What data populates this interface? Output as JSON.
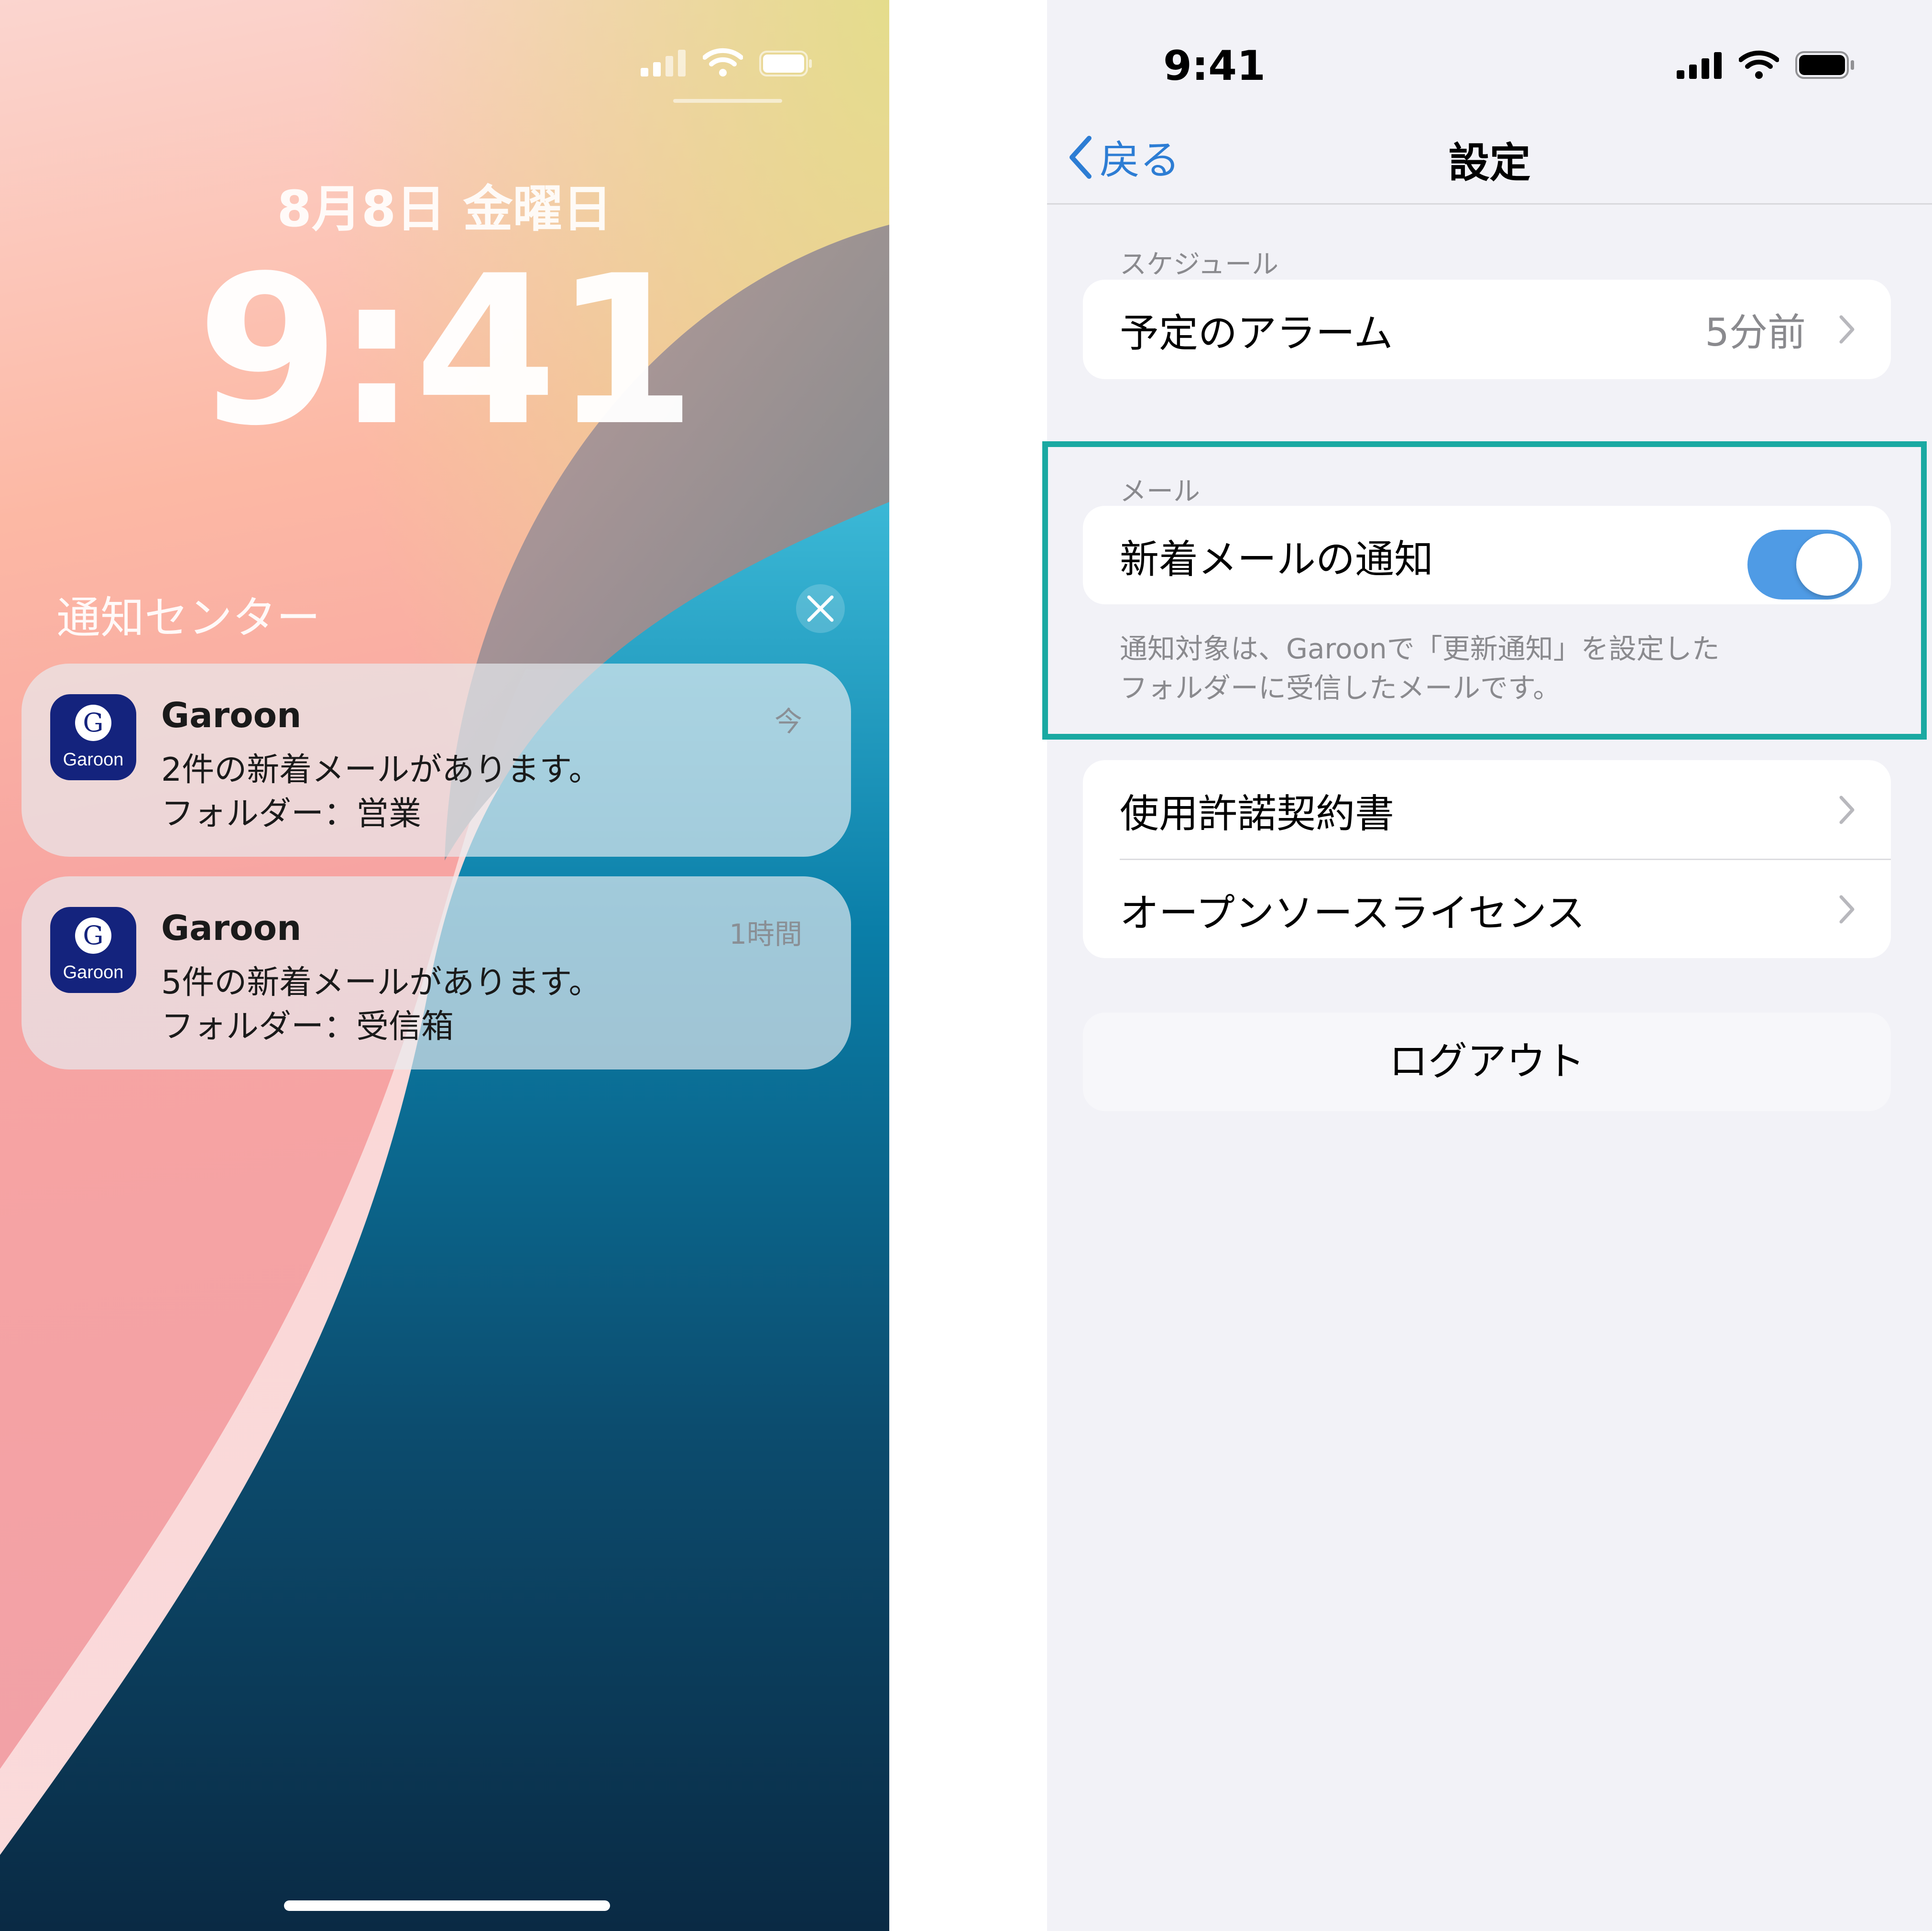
{
  "lock_screen": {
    "date": "8月8日 金曜日",
    "time": "9:41",
    "notification_center_title": "通知センター",
    "notifications": [
      {
        "app": "Garoon",
        "icon_text": "Garoon",
        "icon_letter": "G",
        "time": "今",
        "line1": "2件の新着メールがあります。",
        "line2": "フォルダー：営業"
      },
      {
        "app": "Garoon",
        "icon_text": "Garoon",
        "icon_letter": "G",
        "time": "1時間",
        "line1": "5件の新着メールがあります。",
        "line2": "フォルダー：受信箱"
      }
    ]
  },
  "settings": {
    "status_time": "9:41",
    "back_label": "戻る",
    "title": "設定",
    "schedule": {
      "section_label": "スケジュール",
      "alarm_label": "予定のアラーム",
      "alarm_value": "5分前"
    },
    "mail": {
      "section_label": "メール",
      "new_mail_label": "新着メールの通知",
      "toggle_on": true,
      "footnote_line1": "通知対象は、Garoonで「更新通知」を設定した",
      "footnote_line2": "フォルダーに受信したメールです。"
    },
    "legal": {
      "license_label": "使用許諾契約書",
      "oss_label": "オープンソースライセンス"
    },
    "logout_label": "ログアウト"
  },
  "colors": {
    "accent_blue": "#2d7dd4",
    "toggle_on": "#4f9be5",
    "highlight_teal": "#1aa9a2",
    "garoon_navy": "#14237d"
  },
  "icons": [
    "cellular-signal-icon",
    "wifi-icon",
    "battery-icon",
    "close-icon",
    "chevron-left-icon",
    "chevron-right-icon",
    "garoon-app-icon"
  ]
}
